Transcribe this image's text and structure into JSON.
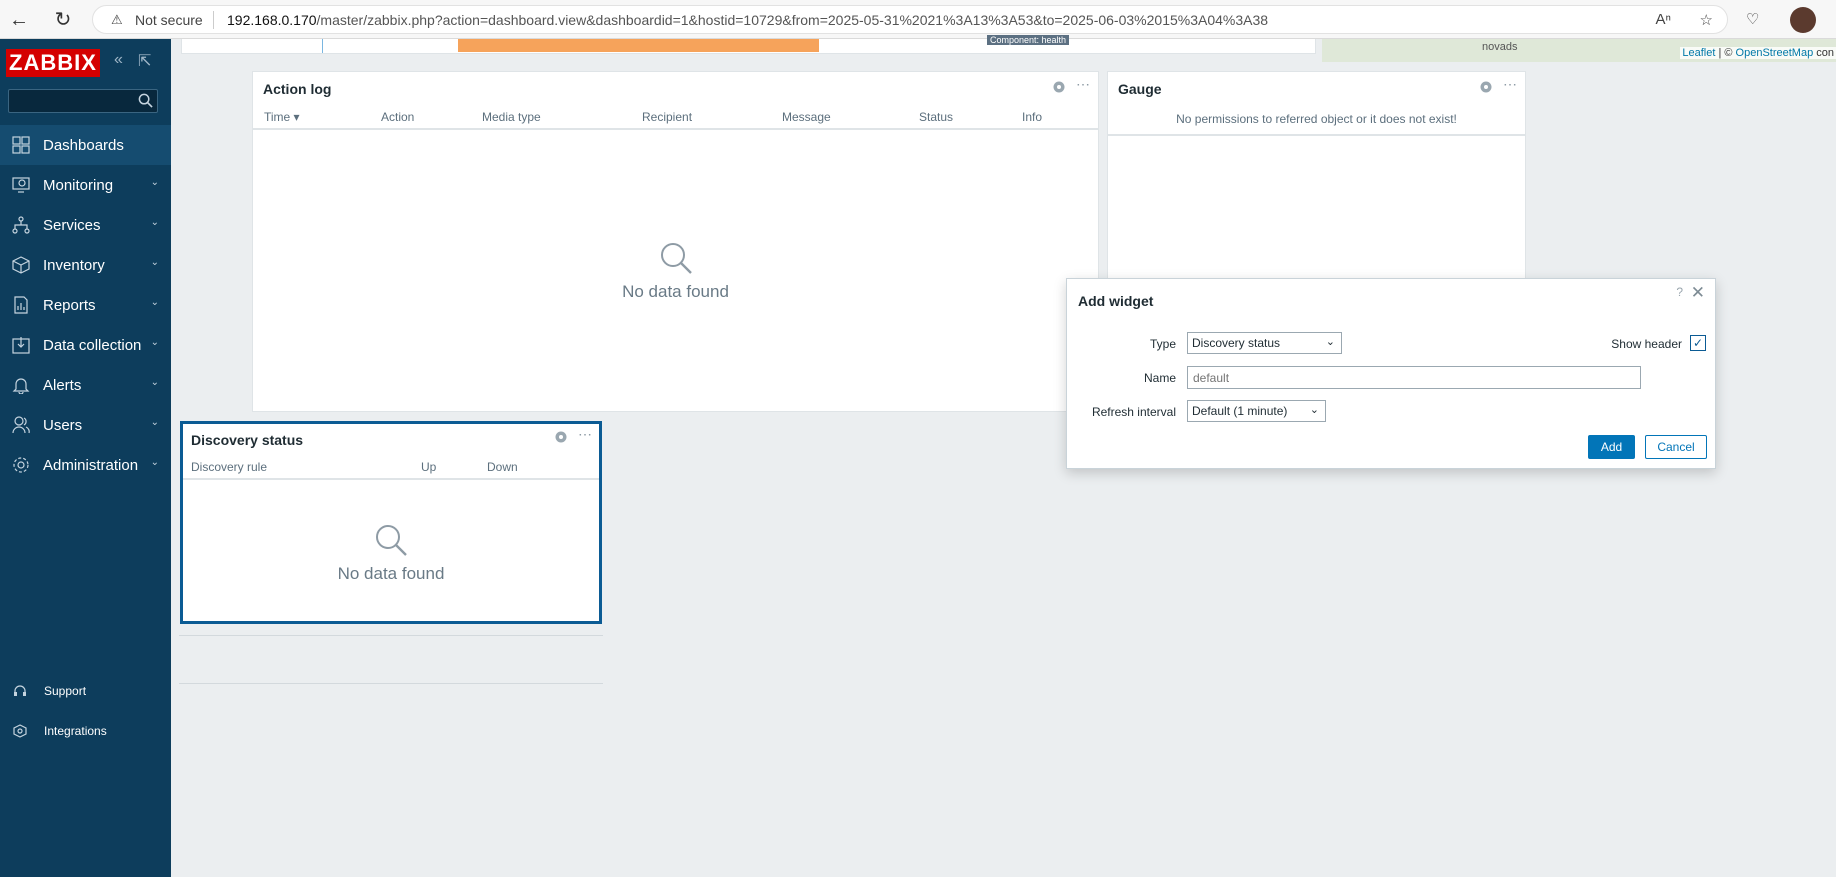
{
  "browser": {
    "security_label": "Not secure",
    "url_host": "192.168.0.170",
    "url_path": "/master/zabbix.php?action=dashboard.view&dashboardid=1&hostid=10729&from=2025-05-31%2021%3A13%3A53&to=2025-06-03%2015%3A04%3A38"
  },
  "sidebar": {
    "logo": "ZABBIX",
    "menu": [
      {
        "label": "Dashboards",
        "icon": "dashboards-icon",
        "active": true
      },
      {
        "label": "Monitoring",
        "icon": "monitoring-icon"
      },
      {
        "label": "Services",
        "icon": "services-icon"
      },
      {
        "label": "Inventory",
        "icon": "inventory-icon"
      },
      {
        "label": "Reports",
        "icon": "reports-icon"
      },
      {
        "label": "Data collection",
        "icon": "data-collection-icon"
      },
      {
        "label": "Alerts",
        "icon": "alerts-icon"
      },
      {
        "label": "Users",
        "icon": "users-icon"
      },
      {
        "label": "Administration",
        "icon": "administration-icon"
      }
    ],
    "bottom": [
      {
        "label": "Support",
        "icon": "headset-icon"
      },
      {
        "label": "Integrations",
        "icon": "integrations-icon"
      }
    ]
  },
  "top_widgets": {
    "clipped_tag": "Component: health",
    "map_place": "novads",
    "map_attr_leaflet": "Leaflet",
    "map_attr_sep": " | © ",
    "map_attr_osm": "OpenStreetMap",
    "map_attr_more": " con"
  },
  "action_log": {
    "title": "Action log",
    "columns": [
      "Time ▾",
      "Action",
      "Media type",
      "Recipient",
      "Message",
      "Status",
      "Info"
    ],
    "empty": "No data found"
  },
  "gauge": {
    "title": "Gauge",
    "message": "No permissions to referred object or it does not exist!"
  },
  "discovery": {
    "title": "Discovery status",
    "columns": [
      "Discovery rule",
      "Up",
      "Down"
    ],
    "empty": "No data found"
  },
  "dialog": {
    "title": "Add widget",
    "help": "?",
    "type_label": "Type",
    "type_value": "Discovery status",
    "show_header_label": "Show header",
    "show_header_checked": true,
    "name_label": "Name",
    "name_placeholder": "default",
    "refresh_label": "Refresh interval",
    "refresh_value": "Default (1 minute)",
    "add_label": "Add",
    "cancel_label": "Cancel"
  }
}
